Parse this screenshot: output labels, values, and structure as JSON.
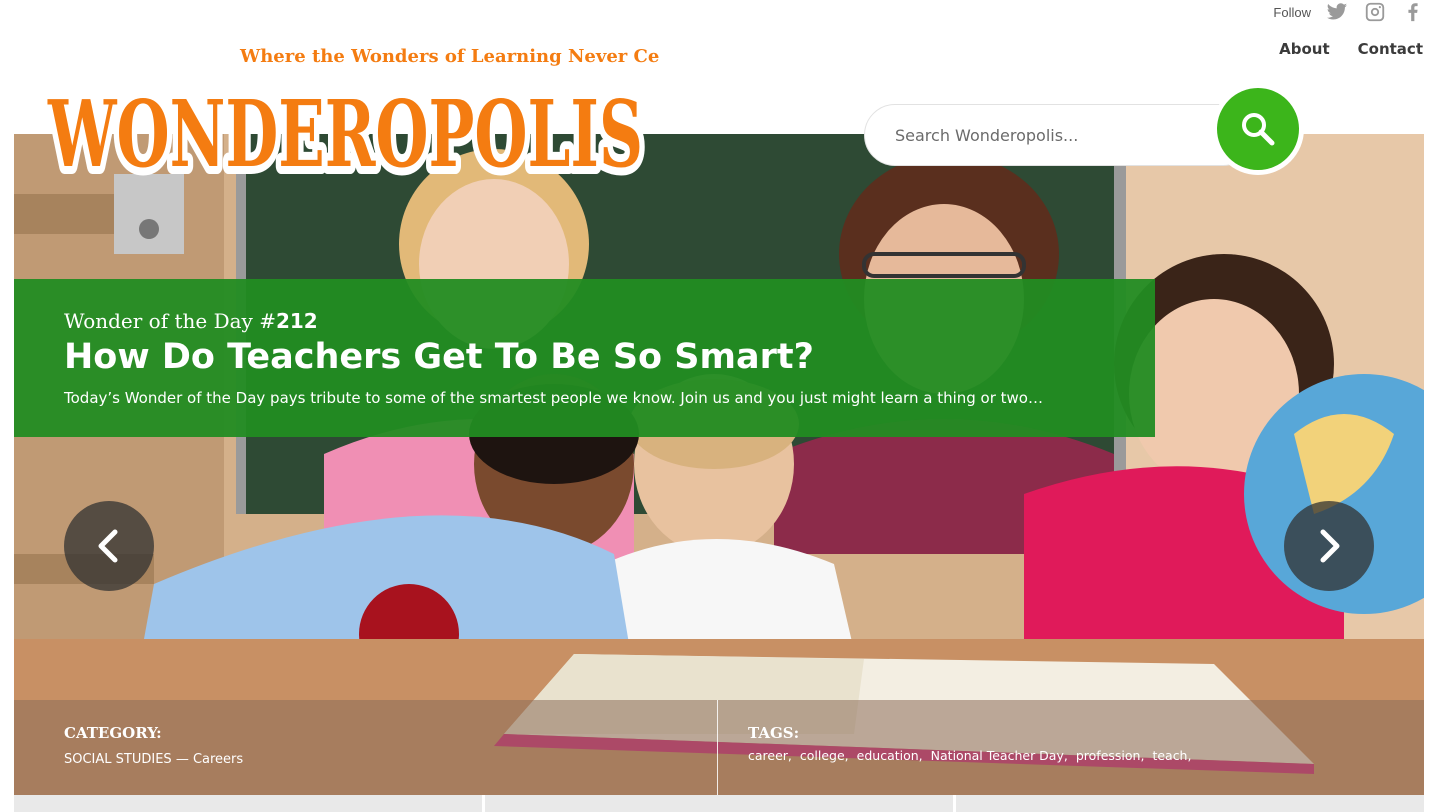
{
  "follow": {
    "label": "Follow",
    "icons": [
      "twitter-icon",
      "instagram-icon",
      "facebook-icon"
    ]
  },
  "nav": {
    "about": "About",
    "contact": "Contact"
  },
  "logo": {
    "tagline": "Where the Wonders of Learning Never Cease",
    "wordmark": "WONDEROPOLIS",
    "color": "#f47c11"
  },
  "search": {
    "placeholder": "Search Wonderopolis...",
    "button_color": "#3cb51b"
  },
  "banner": {
    "kicker_text": "Wonder of the Day #",
    "number": "212",
    "title": "How Do Teachers Get To Be So Smart?",
    "description": "Today’s Wonder of the Day pays tribute to some of the smartest people we know. Join us and you just might learn a thing or two…",
    "color": "#228c22"
  },
  "meta": {
    "category_label": "CATEGORY:",
    "category_value": "SOCIAL STUDIES — Careers",
    "tags_label": "TAGS:",
    "tags": [
      "career,",
      "college,",
      "education,",
      "National Teacher Day,",
      "profession,",
      "teach,"
    ]
  }
}
